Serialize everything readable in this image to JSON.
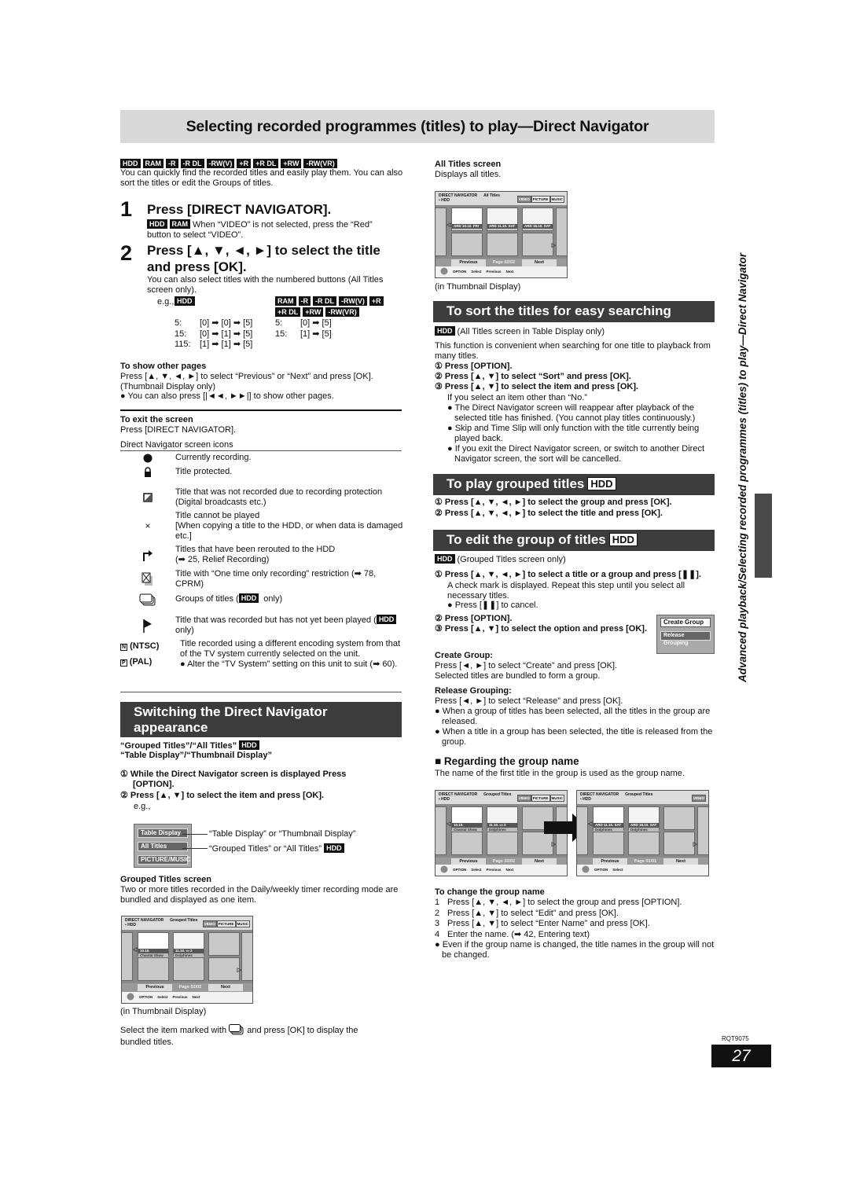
{
  "title": "Selecting recorded programmes (titles) to play—Direct Navigator",
  "side_text": "Advanced playback/Selecting recorded programmes (titles) to play—Direct Navigator",
  "disc_badges": [
    "HDD",
    "RAM",
    "-R",
    "-R DL",
    "-RW(V)",
    "+R",
    "+R DL",
    "+RW",
    "-RW(VR)"
  ],
  "intro": "You can quickly find the recorded titles and easily play them. You can also sort the titles or edit the Groups of titles.",
  "step1": {
    "num": "1",
    "heading": "Press [DIRECT NAVIGATOR].",
    "badges": [
      "HDD",
      "RAM"
    ],
    "note": "When “VIDEO” is not selected, press the “Red” button to select “VIDEO”."
  },
  "step2": {
    "num": "2",
    "heading": "Press [▲, ▼, ◄, ►] to select the title and press [OK].",
    "note": "You can also select titles with the numbered buttons (All Titles screen only).",
    "eg": "e.g.,",
    "hdd_badge": "HDD",
    "other_badges": [
      "RAM",
      "-R",
      "-R DL",
      "-RW(V)",
      "+R",
      "+R DL",
      "+RW",
      "-RW(VR)"
    ],
    "hdd_rows": [
      [
        "5:",
        "[0] ➡ [0] ➡ [5]"
      ],
      [
        "15:",
        "[0] ➡ [1] ➡ [5]"
      ],
      [
        "115:",
        "[1] ➡ [1] ➡ [5]"
      ]
    ],
    "other_rows": [
      [
        "5:",
        "[0] ➡ [5]"
      ],
      [
        "15:",
        "[1] ➡ [5]"
      ]
    ]
  },
  "other_pages": {
    "heading": "To show other pages",
    "text": "Press [▲, ▼, ◄, ►] to select “Previous” or “Next” and press [OK]. (Thumbnail Display only)",
    "bullet": "You can also press [|◄◄, ►►|] to show other pages."
  },
  "exit": {
    "heading": "To exit the screen",
    "text": "Press [DIRECT NAVIGATOR]."
  },
  "icons_heading": "Direct Navigator screen icons",
  "icons": [
    {
      "icon": "record-dot-icon",
      "text": "Currently recording."
    },
    {
      "icon": "lock-icon",
      "text": "Title protected."
    },
    {
      "icon": "recording-protection-icon",
      "text": "Title that was not recorded due to recording protection (Digital broadcasts etc.)"
    },
    {
      "icon": "cross-icon",
      "text": "Title cannot be played",
      "extra": "[When copying a title to the HDD, or when data is damaged etc.]"
    },
    {
      "icon": "reroute-arrow-icon",
      "text": "Titles that have been rerouted to the HDD",
      "extra": "(➡ 25, Relief Recording)"
    },
    {
      "icon": "one-time-recording-icon",
      "text": "Title with “One time only recording” restriction (➡ 78, CPRM)"
    },
    {
      "icon": "group-icon",
      "text": "Groups of titles (",
      "badge": "HDD",
      "tail": " only)"
    },
    {
      "icon": "flag-icon",
      "text": "Title that was recorded but has not yet been played (",
      "badge": "HDD",
      "tail": " only)"
    },
    {
      "icon": "ntsc-pal-icon",
      "ntsc": "(NTSC)",
      "pal": "(PAL)",
      "text": "Title recorded using a different encoding system from that of the TV system currently selected on the unit.",
      "bullet": "Alter the “TV System” setting on this unit to suit (➡ 60)."
    }
  ],
  "switching": {
    "heading": "Switching the Direct Navigator appearance",
    "line1": "“Grouped Titles”/“All Titles”",
    "badge": "HDD",
    "line2": "“Table Display”/“Thumbnail Display”",
    "steps": [
      "While the Direct Navigator screen is displayed Press [OPTION].",
      "Press [▲, ▼] to select the item and press [OK]."
    ],
    "eg": "e.g.,",
    "menu": [
      "Table Display",
      "All Titles",
      "PICTURE/MUSIC"
    ],
    "callouts": [
      "“Table Display” or “Thumbnail Display”",
      "“Grouped Titles” or “All Titles”"
    ]
  },
  "grouped_screen": {
    "heading": "Grouped Titles screen",
    "text": "Two or more titles recorded in the Daily/weekly timer recording mode are bundled and displayed as one item.",
    "caption": "(in Thumbnail Display)",
    "select_pre": "Select the item marked with",
    "select_post": "and press [OK] to display the bundled titles."
  },
  "all_titles": {
    "heading": "All Titles screen",
    "text": "Displays all titles.",
    "caption": "(in Thumbnail Display)"
  },
  "screens": {
    "all": {
      "title": "DIRECT NAVIGATOR",
      "mode": "All Titles",
      "drive": "HDD",
      "tabs": [
        "VIDEO",
        "PICTURE",
        "MUSIC"
      ],
      "cells": [
        {
          "bar": "ARD 10.10. FRI"
        },
        {
          "bar": "ARD 11.10. SAT"
        },
        {
          "bar": "ARD 18.10. SAT"
        }
      ],
      "prev": "Previous",
      "page": "Page 02/02",
      "next": "Next",
      "foot": [
        "OPTION",
        "Select",
        "Previous",
        "Next"
      ]
    },
    "grouped": {
      "title": "DIRECT NAVIGATOR",
      "mode": "Grouped Titles",
      "drive": "HDD",
      "tabs": [
        "VIDEO",
        "PICTURE",
        "MUSIC"
      ],
      "cells": [
        {
          "bar": "10.10.",
          "name": "Chantal Show"
        },
        {
          "bar": "11.10.  ▭ 2",
          "name": "Dolphines"
        }
      ],
      "prev": "Previous",
      "page": "Page 02/02",
      "next": "Next",
      "foot": [
        "OPTION",
        "Select",
        "Previous",
        "Next"
      ]
    },
    "grouped_b": {
      "title": "DIRECT NAVIGATOR",
      "mode": "Grouped Titles",
      "drive": "HDD",
      "tabs": [
        "VIDEO"
      ],
      "cells": [
        {
          "bar": "ARD 11.10. SAT",
          "name": "Dolphines"
        },
        {
          "bar": "ARD 18.10. SAT",
          "name": "Dolphines"
        }
      ],
      "prev": "Previous",
      "page": "Page 01/01",
      "next": "Next",
      "foot": [
        "OPTION",
        "Select"
      ]
    }
  },
  "sort": {
    "heading": "To sort the titles for easy searching",
    "badge": "HDD",
    "scope": "(All Titles screen in Table Display only)",
    "intro": "This function is convenient when searching for one title to playback from many titles.",
    "steps": [
      "Press [OPTION].",
      "Press [▲, ▼] to select “Sort” and press [OK].",
      "Press [▲, ▼] to select the item and press [OK]."
    ],
    "note": "If you select an item other than “No.”",
    "bullets": [
      "The Direct Navigator screen will reappear after playback of the selected title has finished. (You cannot play titles continuously.)",
      "Skip and Time Slip will only function with the title currently being played back.",
      "If you exit the Direct Navigator screen, or switch to another Direct Navigator screen, the sort will be cancelled."
    ]
  },
  "play_grouped": {
    "heading": "To play grouped titles",
    "badge": "HDD",
    "steps": [
      "Press [▲, ▼, ◄, ►] to select the group and press [OK].",
      "Press [▲, ▼, ◄, ►] to select the title and press [OK]."
    ]
  },
  "edit_group": {
    "heading": "To edit the group of titles",
    "badge": "HDD",
    "scope": "(Grouped Titles screen only)",
    "step1": "Press [▲, ▼, ◄, ►] to select a title or a group and press [❚❚].",
    "step1_text": "A check mark is displayed. Repeat this step until you select all necessary titles.",
    "step1_bullet": "Press [❚❚] to cancel.",
    "step2": "Press [OPTION].",
    "step3": "Press [▲, ▼] to select the option and press [OK].",
    "popup": [
      "Create Group",
      "Release Grouping"
    ],
    "create_h": "Create Group:",
    "create_t": "Press [◄, ►] to select “Create” and press [OK]. Selected titles are bundled to form a group.",
    "release_h": "Release Grouping:",
    "release_t": "Press [◄, ►] to select “Release” and press [OK].",
    "release_b": [
      "When a group of titles has been selected, all the titles in the group are released.",
      "When a title in a group has been selected, the title is released from the group."
    ]
  },
  "group_name": {
    "heading": "Regarding the group name",
    "text": "The name of the first title in the group is used as the group name.",
    "change_h": "To change the group name",
    "change_steps": [
      [
        "1",
        "Press [▲, ▼, ◄, ►] to select the group and press [OPTION]."
      ],
      [
        "2",
        "Press [▲, ▼] to select “Edit” and press [OK]."
      ],
      [
        "3",
        "Press [▲, ▼] to select “Enter Name” and press [OK]."
      ],
      [
        "4",
        "Enter the name. (➡ 42, Entering text)"
      ]
    ],
    "bullet": "Even if the group name is changed, the title names in the group will not be changed."
  },
  "doc_code": "RQT9075",
  "page_number": "27"
}
